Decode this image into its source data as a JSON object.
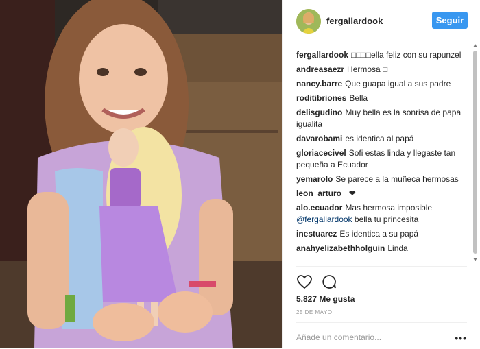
{
  "post": {
    "username": "fergallardook",
    "follow_label": "Seguir",
    "likes": "5.827 Me gusta",
    "date": "25 DE MAYO",
    "add_comment_placeholder": "Añade un comentario...",
    "more_icon": "•••"
  },
  "comments": [
    {
      "user": "fergallardook",
      "text": "□□□□ella feliz con su rapunzel"
    },
    {
      "user": "andreasaezr",
      "text": "Hermosa □"
    },
    {
      "user": "nancy.barre",
      "text": "Que guapa igual a sus padre"
    },
    {
      "user": "roditibriones",
      "text": "Bella"
    },
    {
      "user": "delisgudino",
      "text": "Muy bella es la sonrisa de papa igualita"
    },
    {
      "user": "davarobami",
      "text": "es identica al papá"
    },
    {
      "user": "gloriacecivel",
      "text": "Sofi estas linda y llegaste tan pequeña a Ecuador"
    },
    {
      "user": "yemarolo",
      "text": "Se parece a la muñeca hermosas"
    },
    {
      "user": "leon_arturo_",
      "text": "❤"
    },
    {
      "user": "alo.ecuador",
      "text": "Mas hermosa imposible",
      "mention": "@fergallardook",
      "text2": "bella tu princesita"
    },
    {
      "user": "inestuarez",
      "text": "Es identica a su papá"
    },
    {
      "user": "anahyelizabethholguin",
      "text": "Linda"
    }
  ],
  "colors": {
    "follow": "#3897f0",
    "text": "#262626",
    "muted": "#999999"
  }
}
